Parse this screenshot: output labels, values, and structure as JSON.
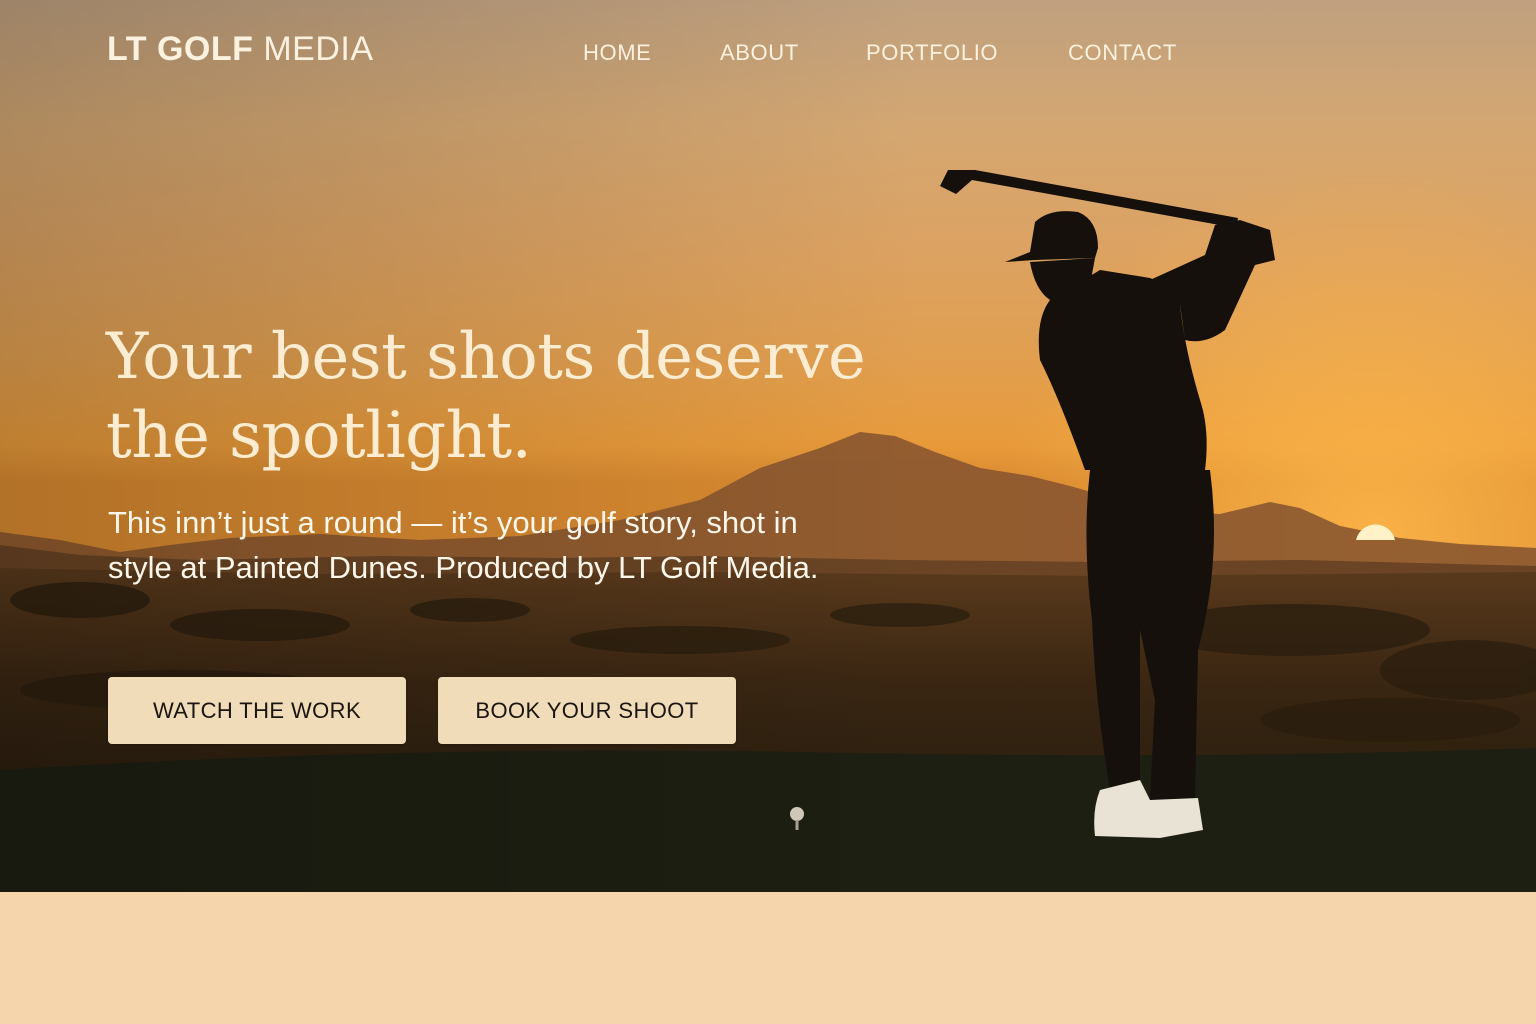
{
  "brand": {
    "logo_bold": "LT GOLF",
    "logo_light": "MEDIA"
  },
  "nav": {
    "items": [
      "HOME",
      "ABOUT",
      "PORTFOLIO",
      "CONTACT"
    ]
  },
  "hero": {
    "headline": "Your best shots deserve the spotlight.",
    "subtext": "This inn’t just a round — it’s your golf story, shot in style at Painted Dunes. Produced by LT Golf Media.",
    "primary_button": "WATCH THE WORK",
    "secondary_button": "BOOK YOUR SHOOT"
  },
  "colors": {
    "nav_text": "#fbf1df",
    "headline": "#fbecd2",
    "button_bg": "#f1dcba",
    "footer_band": "#f5d5ab"
  }
}
